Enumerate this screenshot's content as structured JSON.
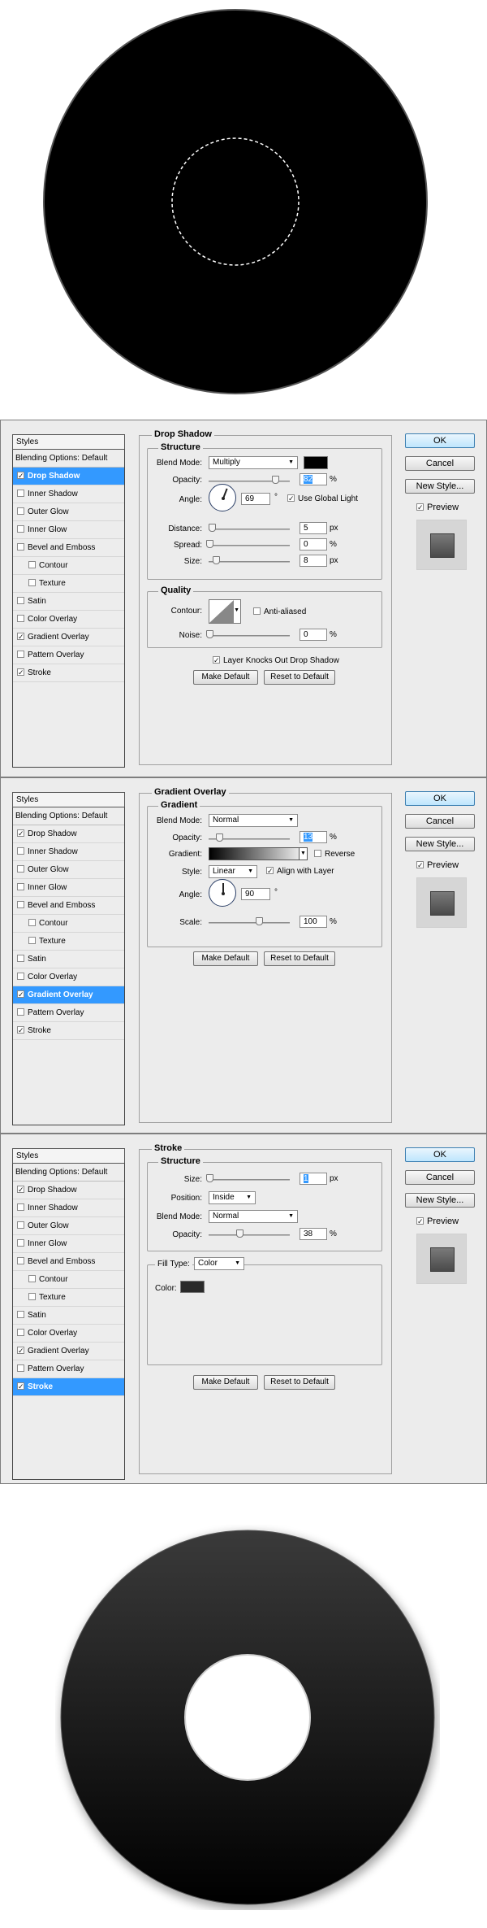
{
  "colors": {
    "panel_bg": "#ececec",
    "selection": "#3399ff",
    "shadow_color": "#000000",
    "stroke_color": "#2a2a2a"
  },
  "common": {
    "styles_title": "Styles",
    "blending_options": "Blending Options: Default",
    "items": [
      "Drop Shadow",
      "Inner Shadow",
      "Outer Glow",
      "Inner Glow",
      "Bevel and Emboss",
      "Contour",
      "Texture",
      "Satin",
      "Color Overlay",
      "Gradient Overlay",
      "Pattern Overlay",
      "Stroke"
    ],
    "ok": "OK",
    "cancel": "Cancel",
    "new_style": "New Style...",
    "preview": "Preview",
    "make_default": "Make Default",
    "reset_default": "Reset to Default",
    "percent": "%",
    "px": "px",
    "degree": "°"
  },
  "drop_shadow": {
    "title": "Drop Shadow",
    "structure": "Structure",
    "blend_mode_label": "Blend Mode:",
    "blend_mode": "Multiply",
    "opacity_label": "Opacity:",
    "opacity": "82",
    "opacity_level": 0.82,
    "angle_label": "Angle:",
    "angle": "69",
    "angle_deg": 69,
    "global_light": "Use Global Light",
    "distance_label": "Distance:",
    "distance": "5",
    "spread_label": "Spread:",
    "spread": "0",
    "size_label": "Size:",
    "size": "8",
    "quality": "Quality",
    "contour_label": "Contour:",
    "anti_aliased": "Anti-aliased",
    "noise_label": "Noise:",
    "noise": "0",
    "knockout": "Layer Knocks Out Drop Shadow"
  },
  "gradient_overlay": {
    "title": "Gradient Overlay",
    "group": "Gradient",
    "blend_mode_label": "Blend Mode:",
    "blend_mode": "Normal",
    "opacity_label": "Opacity:",
    "opacity": "13",
    "opacity_level": 0.13,
    "gradient_label": "Gradient:",
    "reverse": "Reverse",
    "style_label": "Style:",
    "style": "Linear",
    "align": "Align with Layer",
    "angle_label": "Angle:",
    "angle": "90",
    "angle_deg": 90,
    "scale_label": "Scale:",
    "scale": "100"
  },
  "stroke": {
    "title": "Stroke",
    "structure": "Structure",
    "size_label": "Size:",
    "size": "1",
    "position_label": "Position:",
    "position": "Inside",
    "blend_mode_label": "Blend Mode:",
    "blend_mode": "Normal",
    "opacity_label": "Opacity:",
    "opacity": "38",
    "opacity_level": 0.38,
    "fill_type_label": "Fill Type:",
    "fill_type": "Color",
    "color_label": "Color:"
  }
}
